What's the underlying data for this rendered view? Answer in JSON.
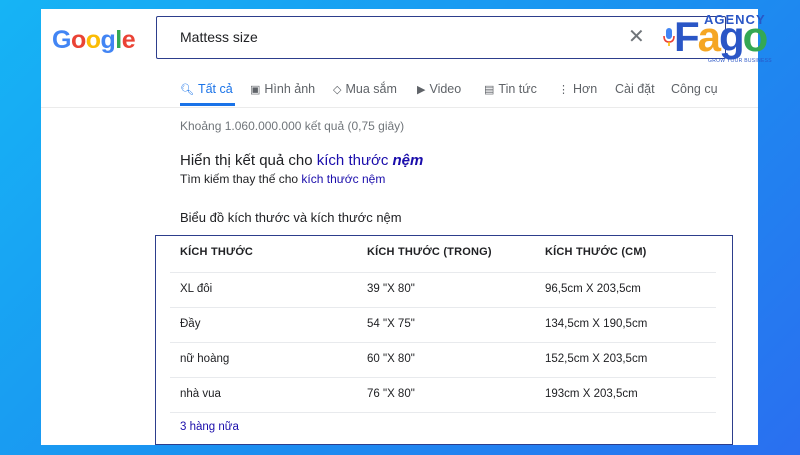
{
  "logo": {
    "letters": [
      "G",
      "o",
      "o",
      "g",
      "l",
      "e"
    ],
    "colors": [
      "#4285f4",
      "#ea4335",
      "#fbbc05",
      "#4285f4",
      "#34a853",
      "#ea4335"
    ]
  },
  "search": {
    "query": "Mattess size"
  },
  "tabs": [
    {
      "label": "Tất cả",
      "icon": "search-icon",
      "active": true
    },
    {
      "label": "Hình ảnh",
      "icon": "image-icon"
    },
    {
      "label": "Mua sắm",
      "icon": "tag-icon"
    },
    {
      "label": "Video",
      "icon": "play-icon"
    },
    {
      "label": "Tin tức",
      "icon": "news-icon"
    },
    {
      "label": "Hơn",
      "icon": "more-vert-icon"
    },
    {
      "label": "Cài đặt"
    },
    {
      "label": "Công cụ"
    }
  ],
  "results": {
    "count": "Khoảng 1.060.000.000 kết quả (0,75 giây)",
    "showing_prefix": "Hiển thị kết quả cho ",
    "showing_link": "kích thước",
    "showing_bold": "nệm",
    "instead_prefix": "Tìm kiếm thay thế cho ",
    "instead_link": "kích thước nệm"
  },
  "chart_title": "Biểu đồ kích thước và kích thước nệm",
  "table": {
    "headers": [
      "KÍCH THƯỚC",
      "KÍCH THƯỚC (TRONG)",
      "KÍCH THƯỚC (CM)"
    ],
    "rows": [
      [
        "XL đôi",
        "39 \"X 80\"",
        "96,5cm X 203,5cm"
      ],
      [
        "Đầy",
        "54 \"X 75\"",
        "134,5cm X 190,5cm"
      ],
      [
        "nữ hoàng",
        "60 \"X 80\"",
        "152,5cm X 203,5cm"
      ],
      [
        "nhà vua",
        "76 \"X 80\"",
        "193cm X 203,5cm"
      ]
    ],
    "more_link": "3 hàng nữa"
  },
  "agency_logo": {
    "top": "AGENCY",
    "letters": [
      "F",
      "a",
      "g",
      "o"
    ],
    "colors": [
      "#2a56c6",
      "#f5a623",
      "#2a56c6",
      "#34a853"
    ],
    "slogan": "GROW YOUR BUSINESS"
  }
}
